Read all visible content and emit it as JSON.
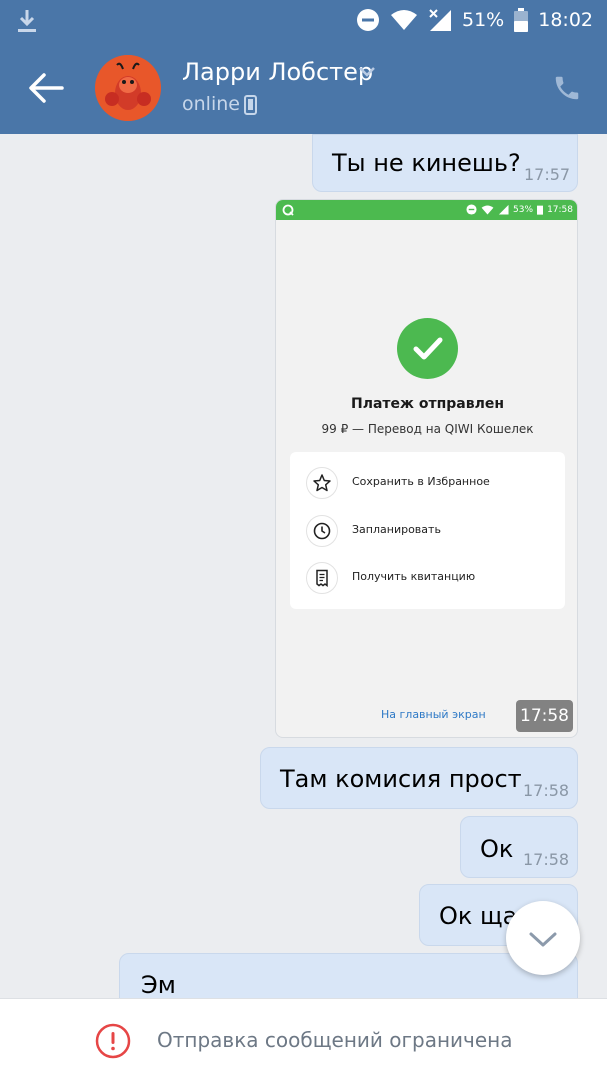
{
  "status_bar": {
    "battery": "51%",
    "time": "18:02"
  },
  "header": {
    "name": "Ларри Лобстер",
    "status": "online"
  },
  "messages": [
    {
      "text": "Ты не кинешь?",
      "time": "17:57"
    },
    {
      "text": "Там комисия прост",
      "time": "17:58"
    },
    {
      "text": "Ок",
      "time": "17:58"
    },
    {
      "text": "Ок ща",
      "time": ""
    },
    {
      "text": "Эм",
      "time": ""
    }
  ],
  "image_message": {
    "time": "17:58",
    "screenshot": {
      "status_battery": "53%",
      "status_time": "17:58",
      "title": "Платеж отправлен",
      "subtitle": "99 ₽ — Перевод на QIWI Кошелек",
      "actions": [
        {
          "label": "Сохранить в Избранное",
          "icon": "star-icon"
        },
        {
          "label": "Запланировать",
          "icon": "clock-icon"
        },
        {
          "label": "Получить квитанцию",
          "icon": "receipt-icon"
        }
      ],
      "home_link": "На главный экран"
    }
  },
  "banner": {
    "text": "Отправка сообщений ограничена",
    "icon": "warning-icon"
  },
  "colors": {
    "header": "#4a76a8",
    "bubble": "#d9e6f7",
    "qiwi_green": "#4cba4f",
    "warning": "#e64646"
  }
}
